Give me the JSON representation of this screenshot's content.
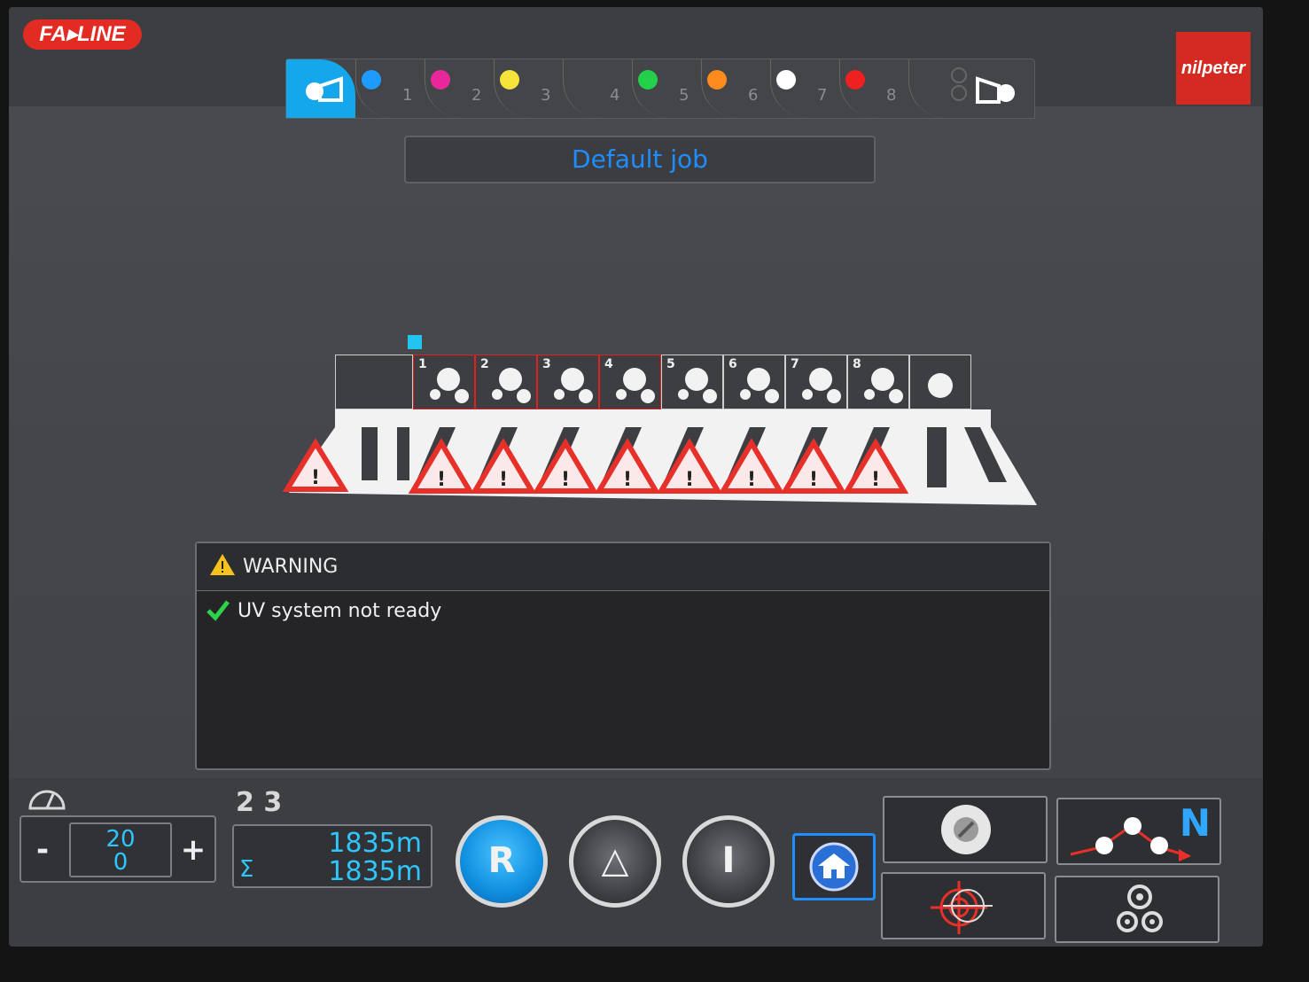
{
  "brand": {
    "line_logo": "FA▸LINE",
    "maker_logo": "nilpeter"
  },
  "station_tabs": [
    {
      "num": "1",
      "ink": "#1e9bff"
    },
    {
      "num": "2",
      "ink": "#e8279a"
    },
    {
      "num": "3",
      "ink": "#f5e23a"
    },
    {
      "num": "4",
      "ink": ""
    },
    {
      "num": "5",
      "ink": "#22d04a"
    },
    {
      "num": "6",
      "ink": "#ff8a1e"
    },
    {
      "num": "7",
      "ink": "#ffffff"
    },
    {
      "num": "8",
      "ink": "#ee2020"
    }
  ],
  "job": {
    "title": "Default job"
  },
  "press": {
    "units": [
      {
        "label": "",
        "active": false
      },
      {
        "label": "1",
        "active": true
      },
      {
        "label": "2",
        "active": true
      },
      {
        "label": "3",
        "active": true
      },
      {
        "label": "4",
        "active": true
      },
      {
        "label": "5",
        "active": false
      },
      {
        "label": "6",
        "active": false
      },
      {
        "label": "7",
        "active": false
      },
      {
        "label": "8",
        "active": false
      },
      {
        "label": "",
        "active": false
      }
    ]
  },
  "warning": {
    "title": "WARNING",
    "messages": [
      {
        "text": "UV system not ready",
        "status": "acknowledged"
      }
    ]
  },
  "speed": {
    "minus": "-",
    "plus": "+",
    "set_value": "20",
    "actual_value": "0"
  },
  "counter": {
    "label": "2 3"
  },
  "meters": {
    "sigma": "Σ",
    "job_length": "1835m",
    "total_length": "1835m"
  },
  "controls": {
    "reset": "R",
    "stop": "△",
    "run": "I"
  },
  "tiles": {
    "web_path_label": "N"
  },
  "colors": {
    "accent": "#1f8fff",
    "value": "#2fc6ff",
    "alarm": "#e22b22"
  }
}
